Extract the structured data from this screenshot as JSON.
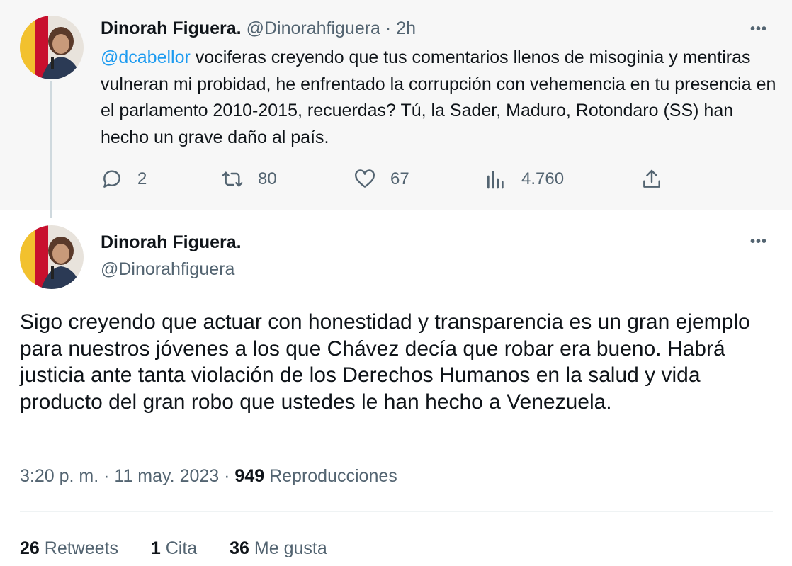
{
  "parent_tweet": {
    "author_name": "Dinorah Figuera.",
    "handle": "@Dinorahfiguera",
    "separator": "·",
    "time_ago": "2h",
    "mention": "@dcabellor",
    "text_after_mention": " vociferas creyendo  que tus comentarios llenos de misoginia y mentiras vulneran mi probidad, he enfrentado la corrupción con vehemencia en tu presencia en el parlamento 2010-2015, recuerdas? Tú, la Sader, Maduro, Rotondaro (SS)  han hecho un grave daño al país.",
    "replies": "2",
    "retweets": "80",
    "likes": "67",
    "views": "4.760"
  },
  "main_tweet": {
    "author_name": "Dinorah Figuera.",
    "handle": "@Dinorahfiguera",
    "text": "Sigo creyendo que actuar con honestidad y transparencia es un gran ejemplo para nuestros jóvenes a los que Chávez decía que robar era bueno. Habrá justicia ante tanta violación de los Derechos Humanos en la salud y vida producto del gran robo que ustedes le han hecho a Venezuela.",
    "time": "3:20 p. m.",
    "date": "11 may. 2023",
    "separator": "·",
    "views_count": "949",
    "views_label": "Reproducciones",
    "retweets_count": "26",
    "retweets_label": "Retweets",
    "quotes_count": "1",
    "quotes_label": "Cita",
    "likes_count": "36",
    "likes_label": "Me gusta"
  },
  "icons": {
    "more": "more-horizontal-icon",
    "reply": "reply-icon",
    "retweet": "retweet-icon",
    "like": "heart-icon",
    "views": "views-bar-chart-icon",
    "share": "share-icon"
  },
  "more_glyph": "•••",
  "colors": {
    "mention": "#1d9bf0",
    "muted": "#536471",
    "text": "#0f1419",
    "parent_background": "#f7f7f7"
  }
}
